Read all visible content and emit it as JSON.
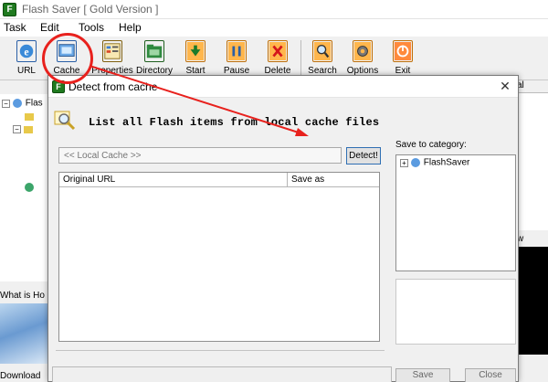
{
  "app": {
    "title": "Flash Saver  [ Gold Version ]"
  },
  "menu": [
    "Task",
    "Edit",
    "Tools",
    "Help"
  ],
  "toolbar": [
    {
      "label": "URL",
      "icon": "ie-icon"
    },
    {
      "label": "Cache",
      "icon": "cache-icon"
    },
    {
      "label": "Properties",
      "icon": "properties-icon"
    },
    {
      "label": "Directory",
      "icon": "directory-icon"
    },
    {
      "label": "Start",
      "icon": "start-icon"
    },
    {
      "label": "Pause",
      "icon": "pause-icon"
    },
    {
      "label": "Delete",
      "icon": "delete-icon"
    },
    {
      "label": "Search",
      "icon": "search-icon"
    },
    {
      "label": "Options",
      "icon": "options-icon"
    },
    {
      "label": "Exit",
      "icon": "exit-icon"
    }
  ],
  "main": {
    "tree_root": "Flas",
    "what_label": "What is Ho",
    "download_label": "Download",
    "right_header": "al",
    "right_mid": "w"
  },
  "dialog": {
    "title": "Detect from cache",
    "heading": "List all Flash items from local cache files",
    "cache_placeholder": "<< Local Cache >>",
    "detect_label": "Detect!",
    "columns": [
      "Original URL",
      "Save as"
    ],
    "save_to_label": "Save to category:",
    "category_root": "FlashSaver",
    "save_label": "Save",
    "close_label": "Close"
  },
  "colors": {
    "highlight": "#e8211d",
    "accent": "#2f6fb3"
  }
}
